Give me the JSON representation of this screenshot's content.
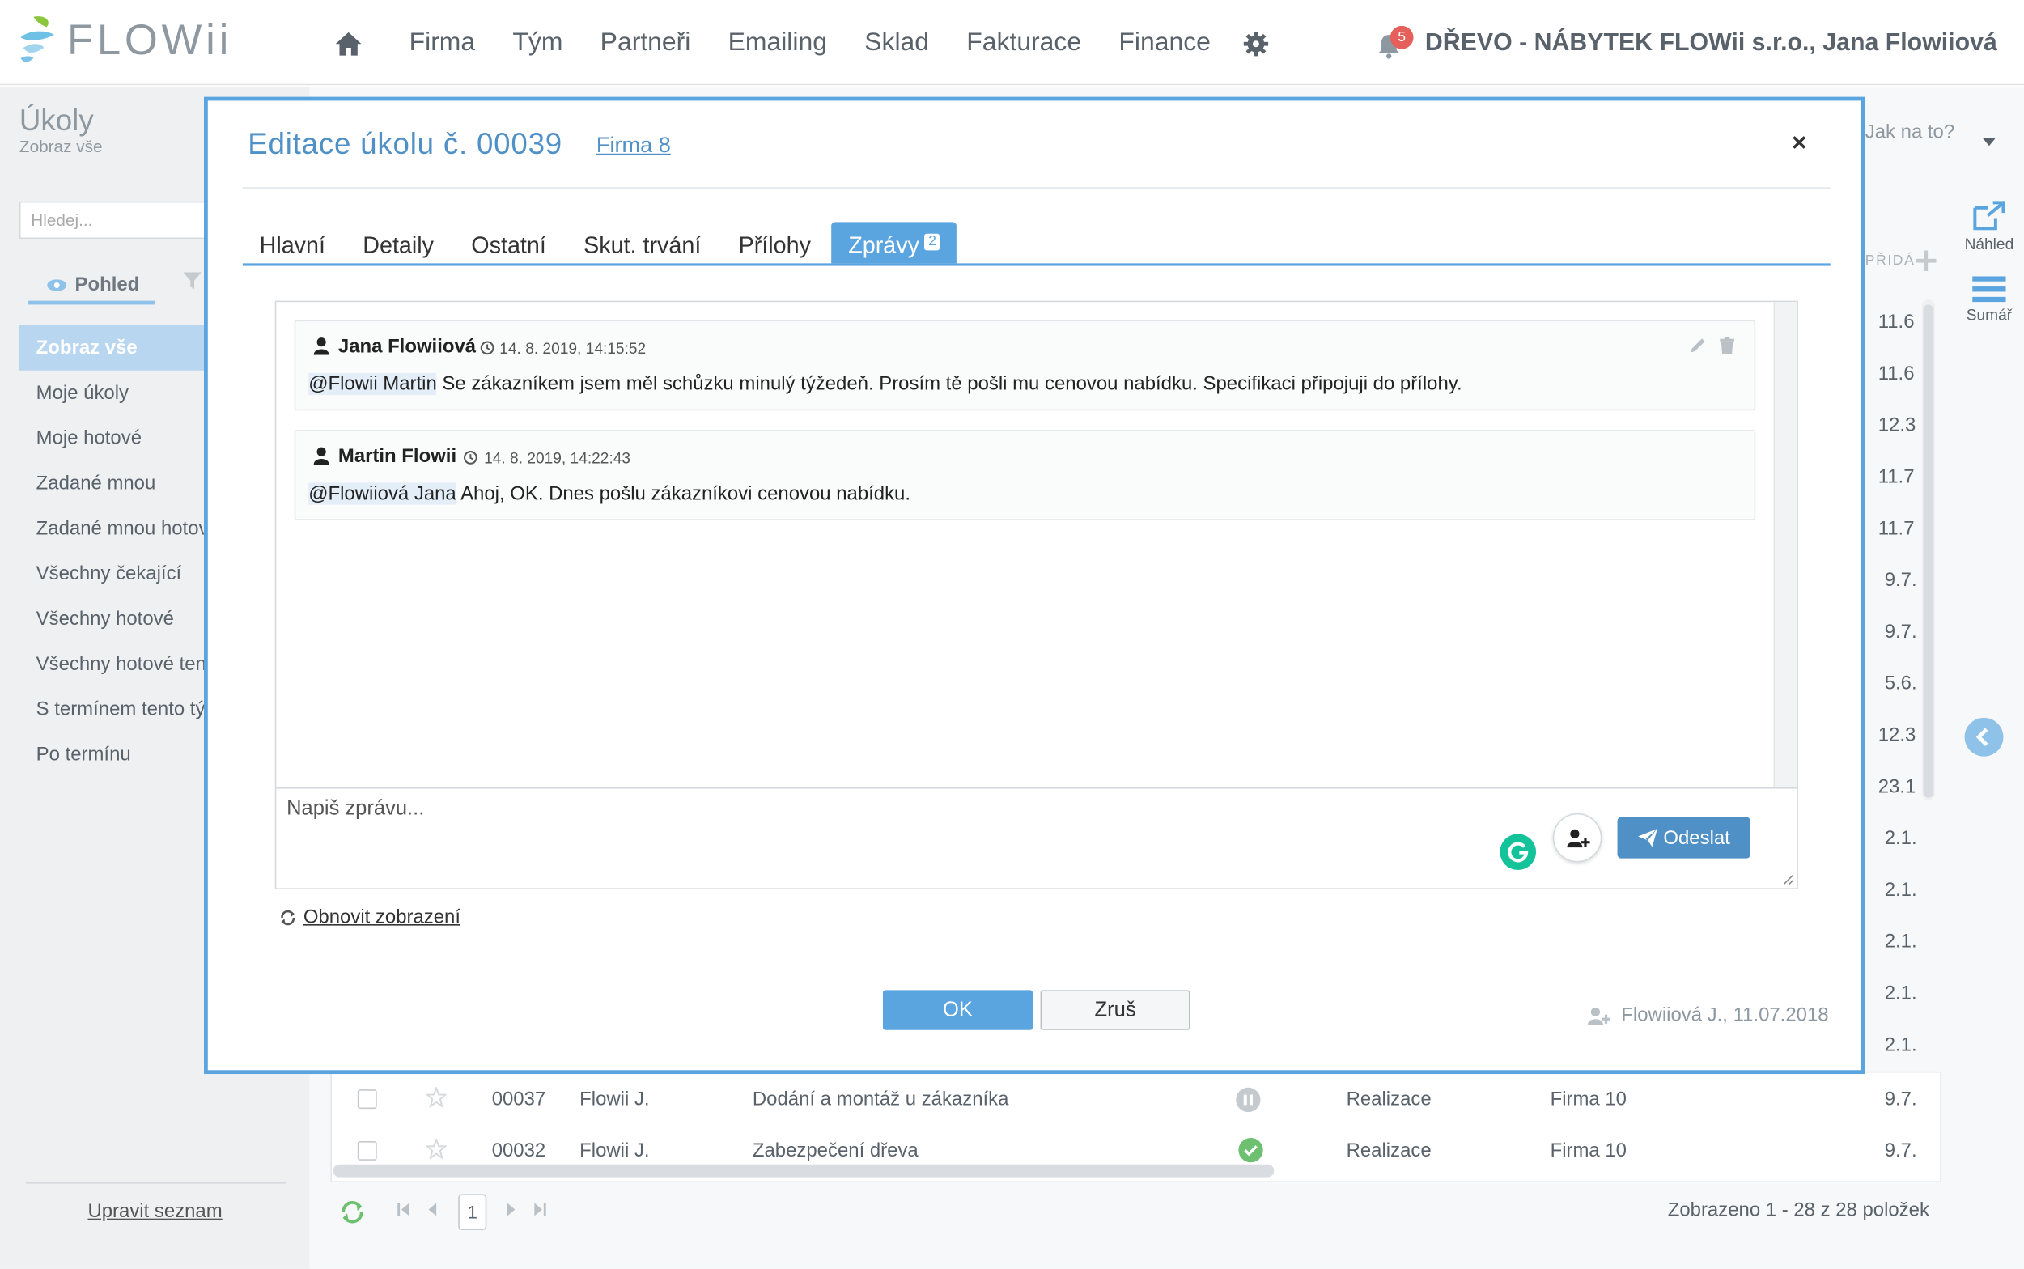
{
  "app": {
    "logo_text": "FLOWii",
    "nav": [
      "Firma",
      "Tým",
      "Partneři",
      "Emailing",
      "Sklad",
      "Fakturace",
      "Finance"
    ],
    "notifications_count": "5",
    "company_user": "DŘEVO - NÁBYTEK FLOWii s.r.o., Jana Flowiiová"
  },
  "page": {
    "title": "Úkoly",
    "subtitle": "Zobraz vše",
    "search_placeholder": "Hledej...",
    "view_tab": "Pohled",
    "menu": [
      "Zobraz vše",
      "Moje úkoly",
      "Moje hotové",
      "Zadané mnou",
      "Zadané mnou hotové",
      "Všechny čekající",
      "Všechny hotové",
      "Všechny hotové tento",
      "S termínem tento týden",
      "Po termínu"
    ],
    "edit_list": "Upravit seznam",
    "howto": "Jak na to?",
    "tool_preview": "Náhled",
    "tool_summary": "Sumář",
    "column_added": "PŘIDÁ",
    "dates": [
      "11.6",
      "11.6",
      "12.3",
      "11.7",
      "11.7",
      "9.7.",
      "9.7.",
      "5.6.",
      "12.3",
      "23.1",
      "2.1.",
      "2.1.",
      "2.1.",
      "2.1.",
      "2.1."
    ],
    "rows": [
      {
        "id": "00037",
        "owner": "Flowii J.",
        "name": "Dodání a montáž u zákazníka",
        "phase": "Realizace",
        "company": "Firma 10",
        "date": "9.7."
      },
      {
        "id": "00032",
        "owner": "Flowii J.",
        "name": "Zabezpečení dřeva",
        "phase": "Realizace",
        "company": "Firma 10",
        "date": "9.7."
      }
    ],
    "page_number": "1",
    "pager_info": "Zobrazeno 1 - 28 z 28 položek"
  },
  "modal": {
    "title": "Editace úkolu č. 00039",
    "company_link": "Firma 8",
    "close": "×",
    "tabs": [
      "Hlavní",
      "Detaily",
      "Ostatní",
      "Skut. trvání",
      "Přílohy"
    ],
    "active_tab": "Zprávy",
    "active_tab_badge": "2",
    "messages": [
      {
        "author": "Jana Flowiiová",
        "time": "14. 8. 2019, 14:15:52",
        "mention": "@Flowii Martin",
        "text": " Se zákazníkem jsem měl schůzku minulý týžedeň. Prosím tě pošli mu cenovou nabídku. Specifikaci připojuji do přílohy."
      },
      {
        "author": "Martin Flowii",
        "time": "14. 8. 2019, 14:22:43",
        "mention": "@Flowiiová Jana",
        "text": " Ahoj, OK. Dnes pošlu zákazníkovi cenovou nabídku."
      }
    ],
    "compose_placeholder": "Napiš zprávu...",
    "send_label": "Odeslat",
    "refresh_label": "Obnovit zobrazení",
    "ok_label": "OK",
    "cancel_label": "Zruš",
    "creator": "Flowiiová J., 11.07.2018"
  }
}
